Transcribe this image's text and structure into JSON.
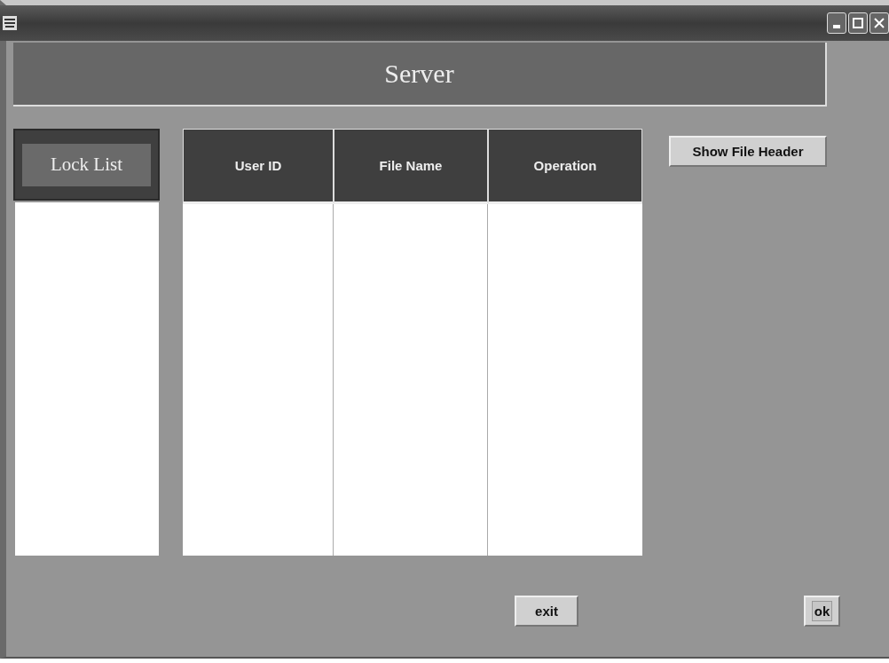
{
  "header": {
    "title": "Server"
  },
  "lock_list": {
    "label": "Lock List"
  },
  "table": {
    "columns": [
      "User ID",
      "File Name",
      "Operation"
    ]
  },
  "side_button": {
    "label": "Show File Header"
  },
  "footer_buttons": [
    {
      "label": "exit",
      "focused": false
    },
    {
      "label": "ok",
      "focused": true
    }
  ]
}
